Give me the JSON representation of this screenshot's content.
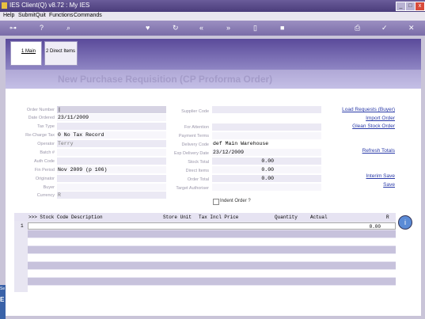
{
  "window": {
    "title": "IES Client(Q) v8.72 : My IES",
    "min_label": "_",
    "max_label": "□",
    "close_label": "x"
  },
  "menu": [
    "Help",
    "Submit",
    "Quit",
    "Functions",
    "Commands"
  ],
  "tabs": [
    {
      "label": "1 Main"
    },
    {
      "label": "2 Direct Items"
    }
  ],
  "heading": "New Purchase Requisition (CP Proforma Order)",
  "left_fields": [
    {
      "label": "Order Number",
      "value": "|"
    },
    {
      "label": "Date Ordered",
      "value": "23/11/2009"
    },
    {
      "label": "Tax Type",
      "value": ""
    },
    {
      "label": "Re-Charge Tax",
      "value": "0 No Tax Record"
    },
    {
      "label": "Operator",
      "value": "Terry"
    },
    {
      "label": "Batch #",
      "value": ""
    },
    {
      "label": "Auth Code",
      "value": ""
    },
    {
      "label": "Fin Period",
      "value": "Nov 2009 (p 106)"
    },
    {
      "label": "Originator",
      "value": ""
    },
    {
      "label": "Buyer",
      "value": ""
    },
    {
      "label": "Currency",
      "value": "R"
    }
  ],
  "right_fields": [
    {
      "label": "Supplier Code",
      "value": ""
    },
    {
      "label": "",
      "value": ""
    },
    {
      "label": "For Attention",
      "value": ""
    },
    {
      "label": "Payment Terms",
      "value": ""
    },
    {
      "label": "Delivery Code",
      "value": "def Main Warehouse"
    },
    {
      "label": "Exp Delivery Date",
      "value": "23/12/2009"
    },
    {
      "label": "Stock Total",
      "value": "0.00"
    },
    {
      "label": "Direct Items",
      "value": "0.00"
    },
    {
      "label": "Order Total",
      "value": "0.00"
    },
    {
      "label": "Target Authoriser",
      "value": ""
    }
  ],
  "indent_label": "Indent Order ?",
  "links": {
    "load": "Load Requests (Buyer)",
    "import": "Import Order",
    "glean": "Glean Stock Order",
    "refresh": "Refresh Totals",
    "interim": "Interim Save",
    "save": "Save"
  },
  "grid": {
    "headers": [
      ">>> Stock Code Description",
      "Store Unit",
      "Tax Incl Price",
      "Quantity",
      "Actual",
      "R"
    ],
    "first_row_num": "1",
    "first_row_value": "0.00"
  },
  "sidebar": {
    "label1": "Se",
    "label2": "E"
  }
}
